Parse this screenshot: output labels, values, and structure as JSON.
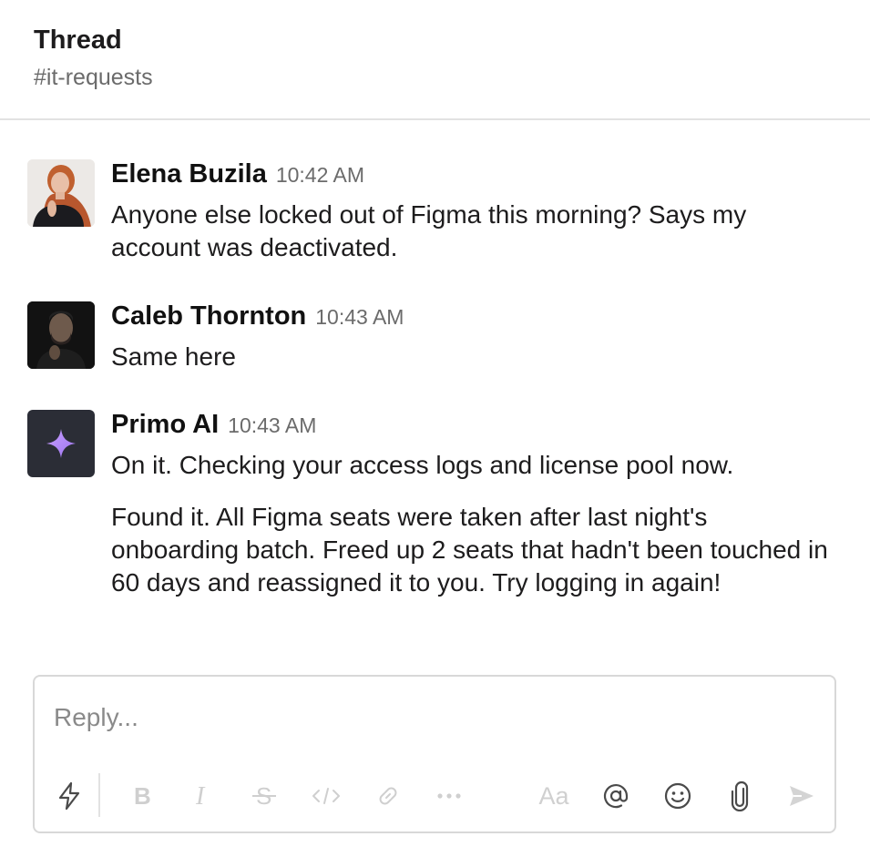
{
  "header": {
    "title": "Thread",
    "channel": "#it-requests"
  },
  "messages": [
    {
      "author": "Elena Buzila",
      "time": "10:42 AM",
      "avatar": "photo-avatar",
      "paragraphs": [
        "Anyone else locked out of Figma this morning? Says my account was deactivated."
      ]
    },
    {
      "author": "Caleb Thornton",
      "time": "10:43 AM",
      "avatar": "photo-avatar",
      "paragraphs": [
        "Same here"
      ]
    },
    {
      "author": "Primo AI",
      "time": "10:43 AM",
      "avatar": "sparkle-icon",
      "paragraphs": [
        "On it. Checking your access logs and license pool now.",
        "Found it. All Figma seats were taken after last night's onboarding batch. Freed up 2 seats that hadn't been touched in 60 days and reassigned it to you. Try logging in again!"
      ]
    }
  ],
  "composer": {
    "placeholder": "Reply...",
    "formatting_label": "Aa",
    "icons": [
      "lightning-icon",
      "bold-icon",
      "italic-icon",
      "strikethrough-icon",
      "code-icon",
      "link-icon",
      "more-icon",
      "format-icon",
      "mention-icon",
      "emoji-icon",
      "attach-icon",
      "send-icon"
    ]
  },
  "colors": {
    "ai_avatar_bg": "#2b2d36",
    "sparkle": "#b58cf2",
    "muted": "#6b6b6b",
    "border": "#d8d8d8"
  }
}
